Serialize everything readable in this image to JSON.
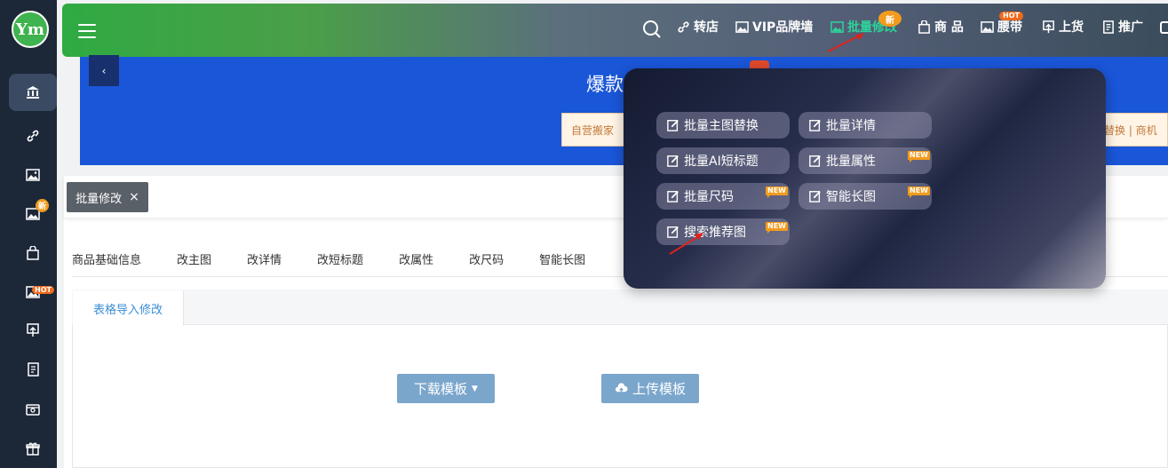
{
  "logo": {
    "text": "Ym"
  },
  "sidebar": {
    "badges": {
      "new": "新",
      "hot": "HOT"
    }
  },
  "topbar": {
    "nav": [
      {
        "label": "转店"
      },
      {
        "label": "VIP品牌墙"
      },
      {
        "label": "批量修改"
      },
      {
        "label": "商 品"
      },
      {
        "label": "腰带"
      },
      {
        "label": "上货"
      },
      {
        "label": "推广"
      }
    ],
    "badge_new": "新",
    "badge_hot": "HOT"
  },
  "banner": {
    "headline": "爆款",
    "chip_left": "自营搬家",
    "chip_right": "替换 | 商机"
  },
  "open_tab": {
    "label": "批量修改",
    "close": "×"
  },
  "sub_tabs": [
    "商品基础信息",
    "改主图",
    "改详情",
    "改短标题",
    "改属性",
    "改尺码",
    "智能长图"
  ],
  "inner_tab": {
    "label": "表格导入修改"
  },
  "buttons": {
    "download": "下载模板",
    "upload": "上传模板"
  },
  "popover": {
    "items": [
      {
        "label": "批量主图替换",
        "tag": ""
      },
      {
        "label": "批量详情",
        "tag": ""
      },
      {
        "label": "批量AI短标题",
        "tag": ""
      },
      {
        "label": "批量属性",
        "tag": "NEW"
      },
      {
        "label": "批量尺码",
        "tag": "NEW"
      },
      {
        "label": "智能长图",
        "tag": "NEW"
      },
      {
        "label": "搜索推荐图",
        "tag": "NEW"
      }
    ]
  },
  "colors": {
    "sidebar": "#1c2738",
    "accent_green": "#2faa42",
    "highlight": "#2ed39a",
    "banner_blue": "#1a56d8",
    "button_blue": "#7ba6cc",
    "badge_orange": "#f29b1d",
    "arrow_red": "#e0221b"
  }
}
